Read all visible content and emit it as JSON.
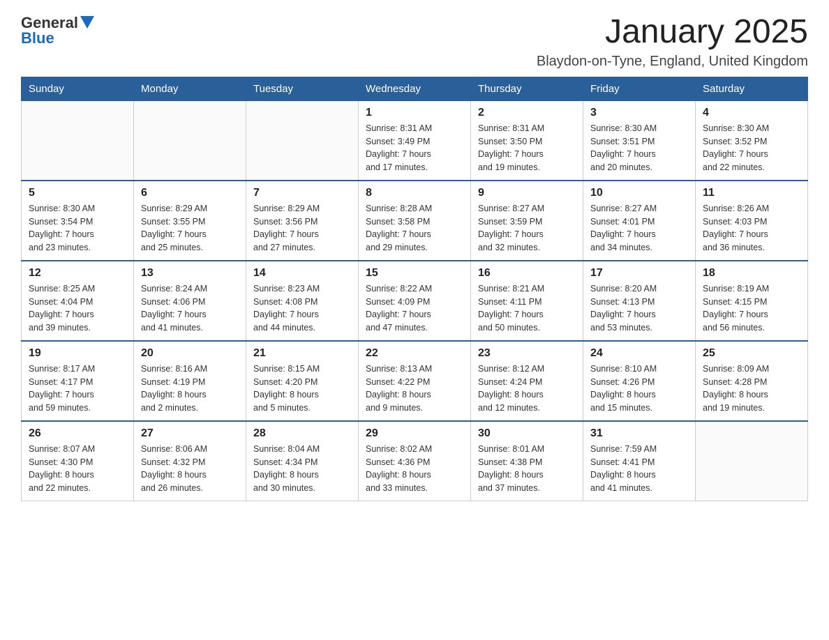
{
  "logo": {
    "text_general": "General",
    "text_blue": "Blue"
  },
  "header": {
    "month_title": "January 2025",
    "location": "Blaydon-on-Tyne, England, United Kingdom"
  },
  "days_of_week": [
    "Sunday",
    "Monday",
    "Tuesday",
    "Wednesday",
    "Thursday",
    "Friday",
    "Saturday"
  ],
  "weeks": [
    [
      {
        "day": "",
        "info": ""
      },
      {
        "day": "",
        "info": ""
      },
      {
        "day": "",
        "info": ""
      },
      {
        "day": "1",
        "info": "Sunrise: 8:31 AM\nSunset: 3:49 PM\nDaylight: 7 hours\nand 17 minutes."
      },
      {
        "day": "2",
        "info": "Sunrise: 8:31 AM\nSunset: 3:50 PM\nDaylight: 7 hours\nand 19 minutes."
      },
      {
        "day": "3",
        "info": "Sunrise: 8:30 AM\nSunset: 3:51 PM\nDaylight: 7 hours\nand 20 minutes."
      },
      {
        "day": "4",
        "info": "Sunrise: 8:30 AM\nSunset: 3:52 PM\nDaylight: 7 hours\nand 22 minutes."
      }
    ],
    [
      {
        "day": "5",
        "info": "Sunrise: 8:30 AM\nSunset: 3:54 PM\nDaylight: 7 hours\nand 23 minutes."
      },
      {
        "day": "6",
        "info": "Sunrise: 8:29 AM\nSunset: 3:55 PM\nDaylight: 7 hours\nand 25 minutes."
      },
      {
        "day": "7",
        "info": "Sunrise: 8:29 AM\nSunset: 3:56 PM\nDaylight: 7 hours\nand 27 minutes."
      },
      {
        "day": "8",
        "info": "Sunrise: 8:28 AM\nSunset: 3:58 PM\nDaylight: 7 hours\nand 29 minutes."
      },
      {
        "day": "9",
        "info": "Sunrise: 8:27 AM\nSunset: 3:59 PM\nDaylight: 7 hours\nand 32 minutes."
      },
      {
        "day": "10",
        "info": "Sunrise: 8:27 AM\nSunset: 4:01 PM\nDaylight: 7 hours\nand 34 minutes."
      },
      {
        "day": "11",
        "info": "Sunrise: 8:26 AM\nSunset: 4:03 PM\nDaylight: 7 hours\nand 36 minutes."
      }
    ],
    [
      {
        "day": "12",
        "info": "Sunrise: 8:25 AM\nSunset: 4:04 PM\nDaylight: 7 hours\nand 39 minutes."
      },
      {
        "day": "13",
        "info": "Sunrise: 8:24 AM\nSunset: 4:06 PM\nDaylight: 7 hours\nand 41 minutes."
      },
      {
        "day": "14",
        "info": "Sunrise: 8:23 AM\nSunset: 4:08 PM\nDaylight: 7 hours\nand 44 minutes."
      },
      {
        "day": "15",
        "info": "Sunrise: 8:22 AM\nSunset: 4:09 PM\nDaylight: 7 hours\nand 47 minutes."
      },
      {
        "day": "16",
        "info": "Sunrise: 8:21 AM\nSunset: 4:11 PM\nDaylight: 7 hours\nand 50 minutes."
      },
      {
        "day": "17",
        "info": "Sunrise: 8:20 AM\nSunset: 4:13 PM\nDaylight: 7 hours\nand 53 minutes."
      },
      {
        "day": "18",
        "info": "Sunrise: 8:19 AM\nSunset: 4:15 PM\nDaylight: 7 hours\nand 56 minutes."
      }
    ],
    [
      {
        "day": "19",
        "info": "Sunrise: 8:17 AM\nSunset: 4:17 PM\nDaylight: 7 hours\nand 59 minutes."
      },
      {
        "day": "20",
        "info": "Sunrise: 8:16 AM\nSunset: 4:19 PM\nDaylight: 8 hours\nand 2 minutes."
      },
      {
        "day": "21",
        "info": "Sunrise: 8:15 AM\nSunset: 4:20 PM\nDaylight: 8 hours\nand 5 minutes."
      },
      {
        "day": "22",
        "info": "Sunrise: 8:13 AM\nSunset: 4:22 PM\nDaylight: 8 hours\nand 9 minutes."
      },
      {
        "day": "23",
        "info": "Sunrise: 8:12 AM\nSunset: 4:24 PM\nDaylight: 8 hours\nand 12 minutes."
      },
      {
        "day": "24",
        "info": "Sunrise: 8:10 AM\nSunset: 4:26 PM\nDaylight: 8 hours\nand 15 minutes."
      },
      {
        "day": "25",
        "info": "Sunrise: 8:09 AM\nSunset: 4:28 PM\nDaylight: 8 hours\nand 19 minutes."
      }
    ],
    [
      {
        "day": "26",
        "info": "Sunrise: 8:07 AM\nSunset: 4:30 PM\nDaylight: 8 hours\nand 22 minutes."
      },
      {
        "day": "27",
        "info": "Sunrise: 8:06 AM\nSunset: 4:32 PM\nDaylight: 8 hours\nand 26 minutes."
      },
      {
        "day": "28",
        "info": "Sunrise: 8:04 AM\nSunset: 4:34 PM\nDaylight: 8 hours\nand 30 minutes."
      },
      {
        "day": "29",
        "info": "Sunrise: 8:02 AM\nSunset: 4:36 PM\nDaylight: 8 hours\nand 33 minutes."
      },
      {
        "day": "30",
        "info": "Sunrise: 8:01 AM\nSunset: 4:38 PM\nDaylight: 8 hours\nand 37 minutes."
      },
      {
        "day": "31",
        "info": "Sunrise: 7:59 AM\nSunset: 4:41 PM\nDaylight: 8 hours\nand 41 minutes."
      },
      {
        "day": "",
        "info": ""
      }
    ]
  ]
}
